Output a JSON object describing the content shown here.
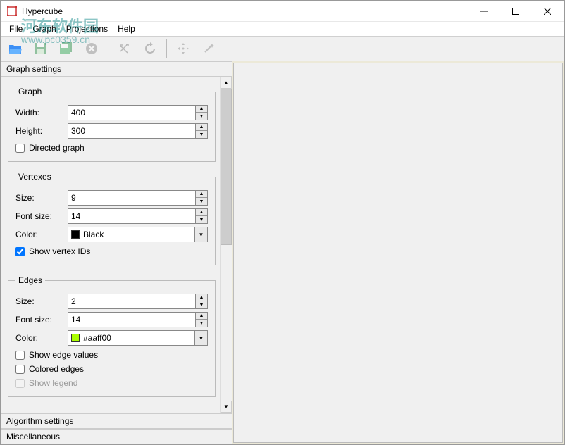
{
  "window": {
    "title": "Hypercube"
  },
  "menu": {
    "file": "File",
    "graph": "Graph",
    "projections": "Projections",
    "help": "Help"
  },
  "watermark": {
    "top": "河东软件园",
    "bottom": "www.pc0359.cn"
  },
  "panel": {
    "graphSettingsHeader": "Graph settings",
    "algorithmSettingsHeader": "Algorithm settings",
    "miscellaneousHeader": "Miscellaneous"
  },
  "graph": {
    "legend": "Graph",
    "widthLabel": "Width:",
    "widthValue": "400",
    "heightLabel": "Height:",
    "heightValue": "300",
    "directedLabel": "Directed graph",
    "directedChecked": false
  },
  "vertexes": {
    "legend": "Vertexes",
    "sizeLabel": "Size:",
    "sizeValue": "9",
    "fontSizeLabel": "Font size:",
    "fontSizeValue": "14",
    "colorLabel": "Color:",
    "colorName": "Black",
    "colorHex": "#000000",
    "showIdsLabel": "Show vertex IDs",
    "showIdsChecked": true
  },
  "edges": {
    "legend": "Edges",
    "sizeLabel": "Size:",
    "sizeValue": "2",
    "fontSizeLabel": "Font size:",
    "fontSizeValue": "14",
    "colorLabel": "Color:",
    "colorName": "#aaff00",
    "colorHex": "#aaff00",
    "showValuesLabel": "Show edge values",
    "showValuesChecked": false,
    "coloredLabel": "Colored edges",
    "coloredChecked": false,
    "showLegendLabel": "Show legend",
    "showLegendChecked": false
  }
}
